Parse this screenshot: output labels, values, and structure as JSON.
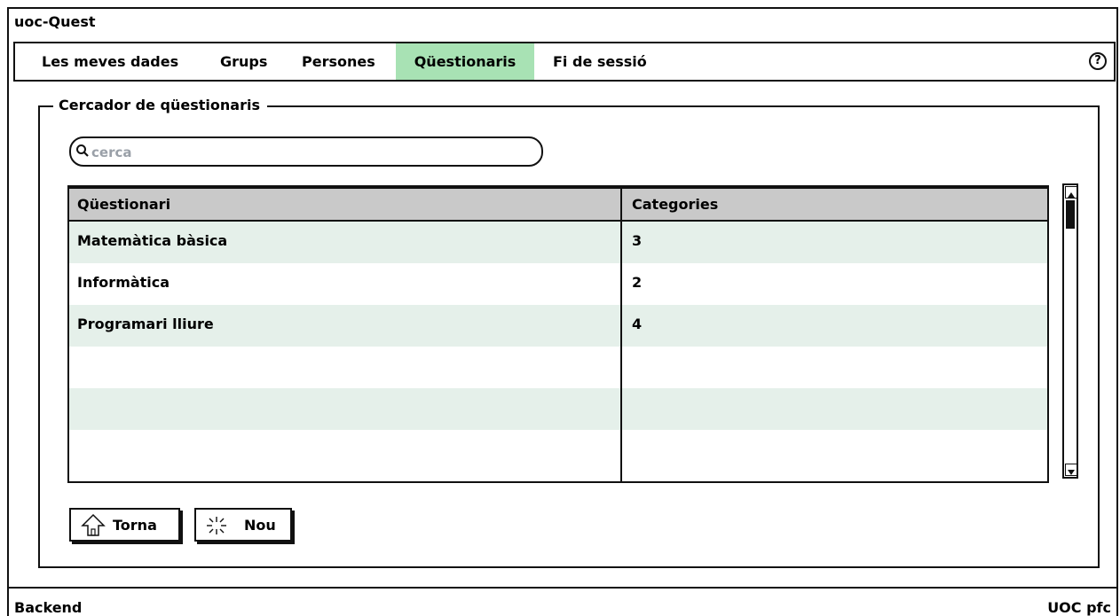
{
  "app": {
    "title": "uoc-Quest"
  },
  "nav": {
    "tabs": [
      {
        "label": "Les meves dades",
        "active": false
      },
      {
        "label": "Grups",
        "active": false
      },
      {
        "label": "Persones",
        "active": false
      },
      {
        "label": "Qüestionaris",
        "active": true
      },
      {
        "label": "Fi de sessió",
        "active": false
      }
    ],
    "help_icon": "help-circle-icon",
    "help_label": "?",
    "active_color": "#a8e2b4"
  },
  "search_panel": {
    "legend": "Cercador de qüestionaris",
    "search": {
      "placeholder": "cerca",
      "value": "",
      "icon": "search-icon"
    }
  },
  "table": {
    "columns": [
      "Qüestionari",
      "Categories"
    ],
    "rows": [
      {
        "questionnaire": "Matemàtica bàsica",
        "categories": "3"
      },
      {
        "questionnaire": "Informàtica",
        "categories": "2"
      },
      {
        "questionnaire": "Programari lliure",
        "categories": "4"
      },
      {
        "questionnaire": "",
        "categories": ""
      },
      {
        "questionnaire": "",
        "categories": ""
      },
      {
        "questionnaire": "",
        "categories": ""
      }
    ],
    "header_color": "#c9c9c9",
    "stripe_color": "#e5f0ea"
  },
  "buttons": {
    "back": {
      "label": "Torna",
      "icon": "home-arrow-icon"
    },
    "new": {
      "label": "Nou",
      "icon": "sparkle-icon"
    }
  },
  "status_bar": {
    "left": "Backend",
    "right": "UOC pfc"
  }
}
